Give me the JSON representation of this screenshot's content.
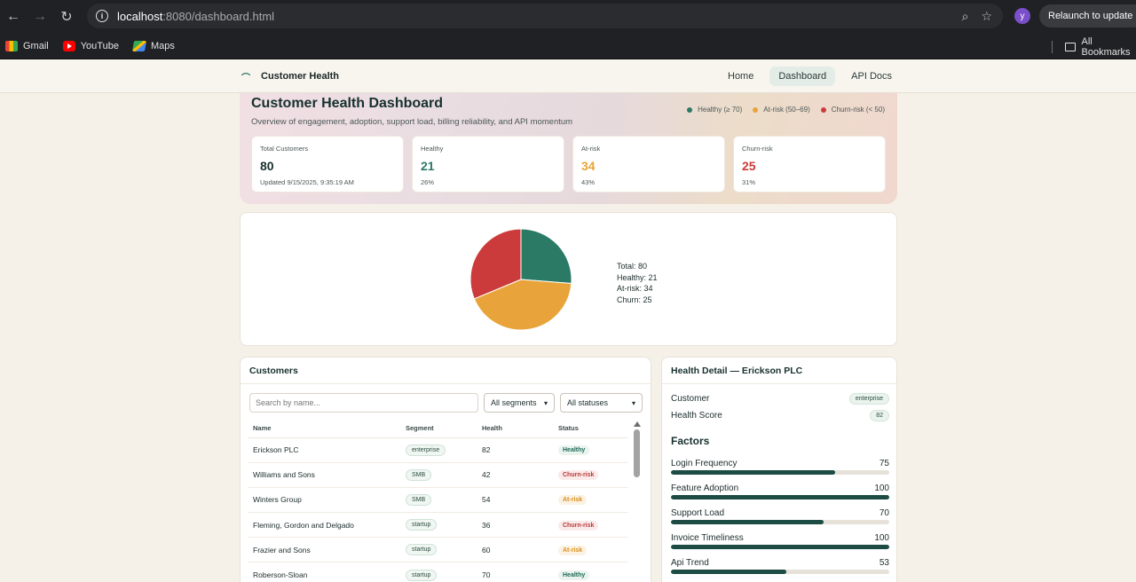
{
  "browser": {
    "url_host": "localhost",
    "url_rest": ":8080/dashboard.html",
    "avatar_letter": "y",
    "relaunch_label": "Relaunch to update",
    "bookmarks": [
      {
        "label": "Gmail",
        "icon": "gmail-icon"
      },
      {
        "label": "YouTube",
        "icon": "youtube-icon"
      },
      {
        "label": "Maps",
        "icon": "maps-icon"
      }
    ],
    "all_bookmarks": "All Bookmarks"
  },
  "app": {
    "brand": "Customer Health",
    "nav": [
      {
        "label": "Home",
        "active": false
      },
      {
        "label": "Dashboard",
        "active": true
      },
      {
        "label": "API Docs",
        "active": false
      }
    ]
  },
  "hero": {
    "title": "Customer Health Dashboard",
    "subtitle": "Overview of engagement, adoption, support load, billing reliability, and API momentum",
    "legend": [
      {
        "label": "Healthy (≥ 70)",
        "color": "#2a7a66"
      },
      {
        "label": "At-risk (50–69)",
        "color": "#e8a43a"
      },
      {
        "label": "Churn-risk (< 50)",
        "color": "#cc3b3b"
      }
    ],
    "kpis": [
      {
        "label": "Total Customers",
        "value": "80",
        "sub": "Updated 9/15/2025, 9:35:19 AM",
        "color": "#17302e"
      },
      {
        "label": "Healthy",
        "value": "21",
        "sub": "26%",
        "color": "#2a7a66"
      },
      {
        "label": "At-risk",
        "value": "34",
        "sub": "43%",
        "color": "#e8a43a"
      },
      {
        "label": "Churn-risk",
        "value": "25",
        "sub": "31%",
        "color": "#cc3b3b"
      }
    ]
  },
  "chart_data": {
    "type": "pie",
    "categories": [
      "Healthy",
      "At-risk",
      "Churn"
    ],
    "values": [
      21,
      34,
      25
    ],
    "colors": [
      "#2a7a66",
      "#e8a43a",
      "#cc3b3b"
    ],
    "stats": [
      "Total: 80",
      "Healthy: 21",
      "At-risk: 34",
      "Churn: 25"
    ]
  },
  "customers": {
    "title": "Customers",
    "search_placeholder": "Search by name...",
    "segment_select": "All segments",
    "status_select": "All statuses",
    "columns": [
      "Name",
      "Segment",
      "Health",
      "Status"
    ],
    "rows": [
      {
        "name": "Erickson PLC",
        "segment": "enterprise",
        "health": "82",
        "status": "Healthy",
        "kind": "healthy"
      },
      {
        "name": "Williams and Sons",
        "segment": "SMB",
        "health": "42",
        "status": "Churn-risk",
        "kind": "churn"
      },
      {
        "name": "Winters Group",
        "segment": "SMB",
        "health": "54",
        "status": "At-risk",
        "kind": "atrisk"
      },
      {
        "name": "Fleming, Gordon and Delgado",
        "segment": "startup",
        "health": "36",
        "status": "Churn-risk",
        "kind": "churn"
      },
      {
        "name": "Frazier and Sons",
        "segment": "startup",
        "health": "60",
        "status": "At-risk",
        "kind": "atrisk"
      },
      {
        "name": "Roberson-Sloan",
        "segment": "startup",
        "health": "70",
        "status": "Healthy",
        "kind": "healthy"
      }
    ]
  },
  "detail": {
    "title": "Health Detail — Erickson PLC",
    "customer_label": "Customer",
    "customer_value": "enterprise",
    "score_label": "Health Score",
    "score_value": "82",
    "factors_title": "Factors",
    "factors": [
      {
        "label": "Login Frequency",
        "value": 75
      },
      {
        "label": "Feature Adoption",
        "value": 100
      },
      {
        "label": "Support Load",
        "value": 70
      },
      {
        "label": "Invoice Timeliness",
        "value": 100
      },
      {
        "label": "Api Trend",
        "value": 53
      }
    ]
  }
}
